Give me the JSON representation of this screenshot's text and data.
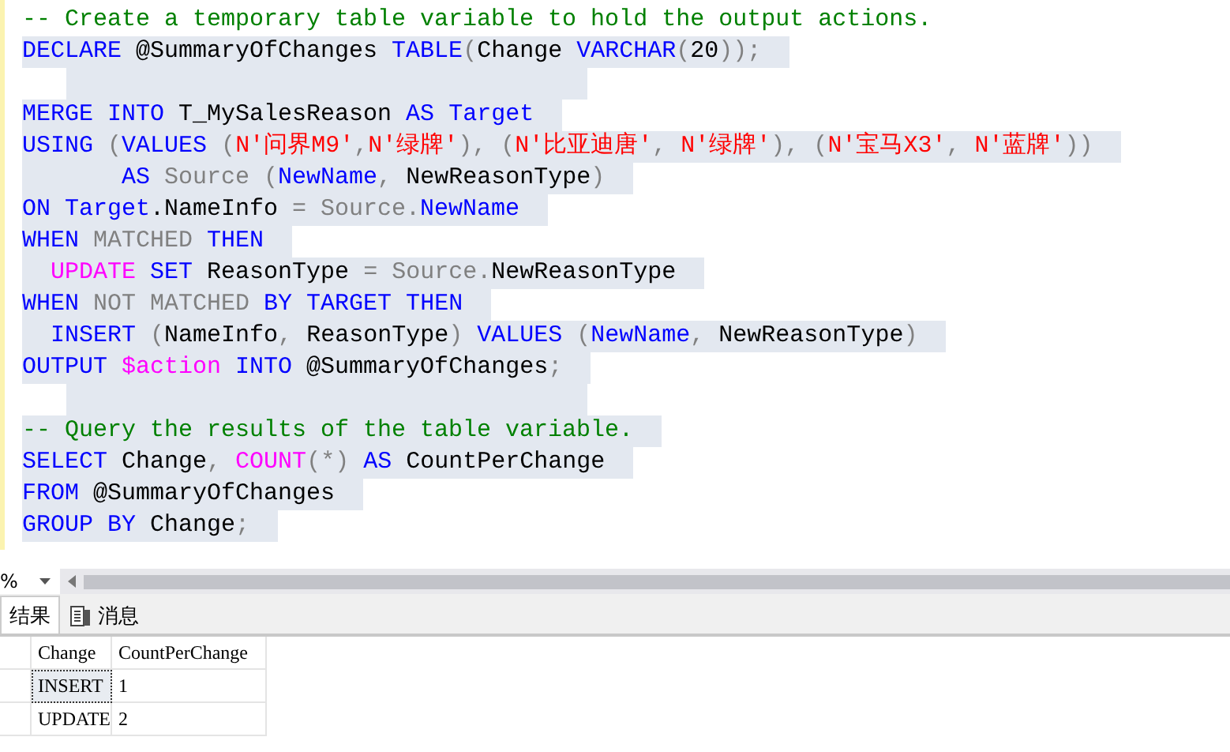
{
  "editor": {
    "lines": [
      {
        "selected": false,
        "tokens": [
          {
            "kind": "comment",
            "text": "-- Create a temporary table variable to hold the output actions."
          }
        ]
      },
      {
        "selected": true,
        "tokens": [
          {
            "kind": "keyword",
            "text": "DECLARE"
          },
          {
            "kind": "ident",
            "text": " @SummaryOfChanges "
          },
          {
            "kind": "keyword",
            "text": "TABLE"
          },
          {
            "kind": "operator",
            "text": "("
          },
          {
            "kind": "ident",
            "text": "Change "
          },
          {
            "kind": "keyword",
            "text": "VARCHAR"
          },
          {
            "kind": "operator",
            "text": "("
          },
          {
            "kind": "ident",
            "text": "20"
          },
          {
            "kind": "operator",
            "text": "));"
          }
        ]
      },
      {
        "selected": true
      },
      {
        "selected": true,
        "tokens": [
          {
            "kind": "keyword",
            "text": "MERGE INTO"
          },
          {
            "kind": "ident",
            "text": " T_MySalesReason "
          },
          {
            "kind": "keyword",
            "text": "AS "
          },
          {
            "kind": "keyword",
            "text": "Target"
          }
        ]
      },
      {
        "selected": true,
        "tokens": [
          {
            "kind": "keyword",
            "text": "USING"
          },
          {
            "kind": "operator",
            "text": " ("
          },
          {
            "kind": "keyword",
            "text": "VALUES"
          },
          {
            "kind": "operator",
            "text": " ("
          },
          {
            "kind": "string",
            "text": "N'问界M9'"
          },
          {
            "kind": "operator",
            "text": ","
          },
          {
            "kind": "string",
            "text": "N'绿牌'"
          },
          {
            "kind": "operator",
            "text": "), ("
          },
          {
            "kind": "string",
            "text": "N'比亚迪唐'"
          },
          {
            "kind": "operator",
            "text": ", "
          },
          {
            "kind": "string",
            "text": "N'绿牌'"
          },
          {
            "kind": "operator",
            "text": "), ("
          },
          {
            "kind": "string",
            "text": "N'宝马X3'"
          },
          {
            "kind": "operator",
            "text": ", "
          },
          {
            "kind": "string",
            "text": "N'蓝牌'"
          },
          {
            "kind": "operator",
            "text": "))"
          }
        ]
      },
      {
        "selected": true,
        "tokens": [
          {
            "kind": "keyword",
            "text": "       AS"
          },
          {
            "kind": "operator",
            "text": " Source ("
          },
          {
            "kind": "keyword",
            "text": "NewName"
          },
          {
            "kind": "operator",
            "text": ","
          },
          {
            "kind": "ident",
            "text": " NewReasonType"
          },
          {
            "kind": "operator",
            "text": ")"
          }
        ]
      },
      {
        "selected": true,
        "tokens": [
          {
            "kind": "keyword",
            "text": "ON Target"
          },
          {
            "kind": "ident",
            "text": ".NameInfo "
          },
          {
            "kind": "operator",
            "text": "= Source."
          },
          {
            "kind": "keyword",
            "text": "NewName"
          }
        ]
      },
      {
        "selected": true,
        "tokens": [
          {
            "kind": "keyword",
            "text": "WHEN"
          },
          {
            "kind": "operator",
            "text": " MATCHED "
          },
          {
            "kind": "keyword",
            "text": "THEN"
          }
        ]
      },
      {
        "selected": true,
        "tokens": [
          {
            "kind": "function",
            "text": "  UPDATE"
          },
          {
            "kind": "keyword",
            "text": " SET"
          },
          {
            "kind": "ident",
            "text": " ReasonType "
          },
          {
            "kind": "operator",
            "text": "= Source."
          },
          {
            "kind": "ident",
            "text": "NewReasonType"
          }
        ]
      },
      {
        "selected": true,
        "tokens": [
          {
            "kind": "keyword",
            "text": "WHEN"
          },
          {
            "kind": "operator",
            "text": " NOT MATCHED "
          },
          {
            "kind": "keyword",
            "text": "BY TARGET THEN"
          }
        ]
      },
      {
        "selected": true,
        "tokens": [
          {
            "kind": "keyword",
            "text": "  INSERT"
          },
          {
            "kind": "operator",
            "text": " ("
          },
          {
            "kind": "ident",
            "text": "NameInfo"
          },
          {
            "kind": "operator",
            "text": ","
          },
          {
            "kind": "ident",
            "text": " ReasonType"
          },
          {
            "kind": "operator",
            "text": ") "
          },
          {
            "kind": "keyword",
            "text": "VALUES"
          },
          {
            "kind": "operator",
            "text": " ("
          },
          {
            "kind": "keyword",
            "text": "NewName"
          },
          {
            "kind": "operator",
            "text": ","
          },
          {
            "kind": "ident",
            "text": " NewReasonType"
          },
          {
            "kind": "operator",
            "text": ")"
          }
        ]
      },
      {
        "selected": true,
        "tokens": [
          {
            "kind": "keyword",
            "text": "OUTPUT"
          },
          {
            "kind": "function",
            "text": " $action"
          },
          {
            "kind": "keyword",
            "text": " INTO"
          },
          {
            "kind": "ident",
            "text": " @SummaryOfChanges"
          },
          {
            "kind": "operator",
            "text": ";"
          }
        ]
      },
      {
        "selected": true
      },
      {
        "selected": true,
        "tokens": [
          {
            "kind": "comment",
            "text": "-- Query the results of the table variable."
          }
        ]
      },
      {
        "selected": true,
        "tokens": [
          {
            "kind": "keyword",
            "text": "SELECT"
          },
          {
            "kind": "ident",
            "text": " Change"
          },
          {
            "kind": "operator",
            "text": ", "
          },
          {
            "kind": "function",
            "text": "COUNT"
          },
          {
            "kind": "operator",
            "text": "(*) "
          },
          {
            "kind": "keyword",
            "text": "AS"
          },
          {
            "kind": "ident",
            "text": " CountPerChange"
          }
        ]
      },
      {
        "selected": true,
        "tokens": [
          {
            "kind": "keyword",
            "text": "FROM"
          },
          {
            "kind": "ident",
            "text": " @SummaryOfChanges"
          }
        ]
      },
      {
        "selected": true,
        "tokens": [
          {
            "kind": "keyword",
            "text": "GROUP BY"
          },
          {
            "kind": "ident",
            "text": " Change"
          },
          {
            "kind": "operator",
            "text": ";"
          }
        ]
      }
    ]
  },
  "zoom": {
    "value": "%"
  },
  "tabs": [
    {
      "label": "结果",
      "selected": true,
      "kind": "grid"
    },
    {
      "label": "消息",
      "selected": false,
      "kind": "messages"
    }
  ],
  "results": {
    "columns": [
      "Change",
      "CountPerChange"
    ],
    "rows": [
      {
        "cells": [
          "INSERT",
          "1"
        ],
        "selected": true
      },
      {
        "cells": [
          "UPDATE",
          "2"
        ],
        "selected": false
      }
    ]
  }
}
